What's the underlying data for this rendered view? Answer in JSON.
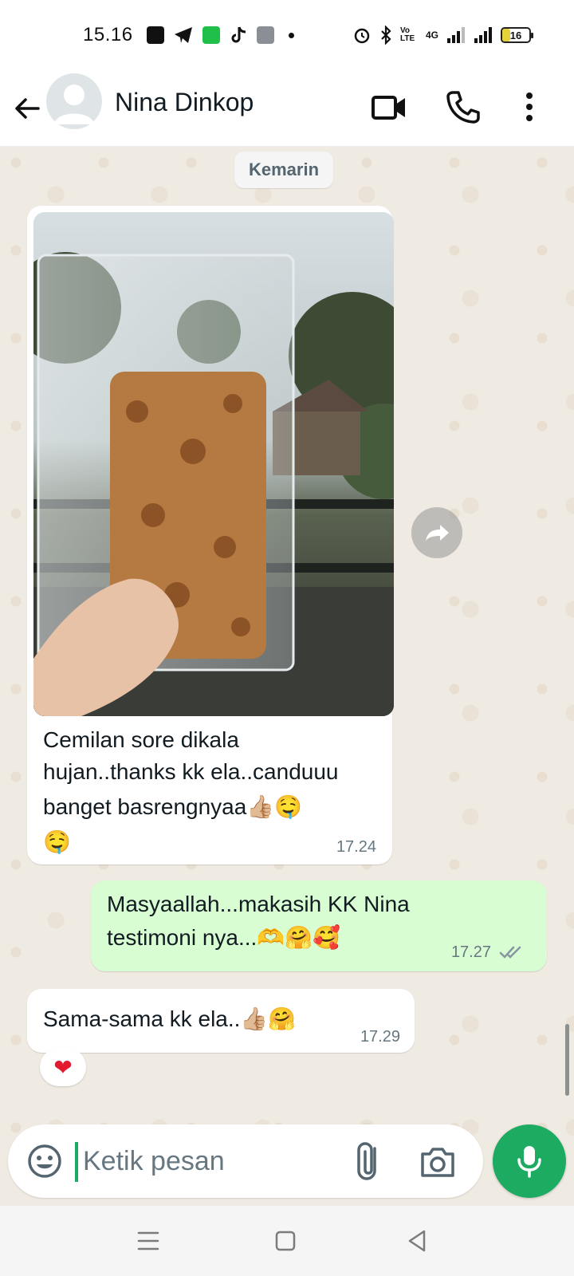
{
  "status_bar": {
    "time": "15.16",
    "battery": "16",
    "network": "4G",
    "volte": "Vo LTE"
  },
  "header": {
    "contact_name": "Nina Dinkop",
    "icons": {
      "back": "arrow-left-icon",
      "video": "video-camera-icon",
      "call": "phone-icon",
      "menu": "more-vertical-icon"
    }
  },
  "chat": {
    "date_chip": "Kemarin",
    "messages": [
      {
        "direction": "incoming",
        "has_photo": true,
        "text_line1": "Cemilan sore dikala",
        "text_line2": "hujan..thanks kk ela..canduuu",
        "text_line3": "banget basrengnyaa👍🏼🤤",
        "text_line4": "🤤",
        "time": "17.24"
      },
      {
        "direction": "outgoing",
        "text_line1": "Masyaallah...makasih KK Nina",
        "text_line2": "testimoni nya...🫶🤗🥰",
        "time": "17.27",
        "status": "read"
      },
      {
        "direction": "incoming",
        "text_line1": "Sama-sama kk ela..👍🏼🤗",
        "time": "17.29",
        "reaction": "❤"
      }
    ]
  },
  "input": {
    "placeholder": "Ketik pesan",
    "value": ""
  },
  "colors": {
    "accent": "#1daa61",
    "outgoing_bubble": "#d9fdd3",
    "chat_bg": "#efeae2"
  }
}
